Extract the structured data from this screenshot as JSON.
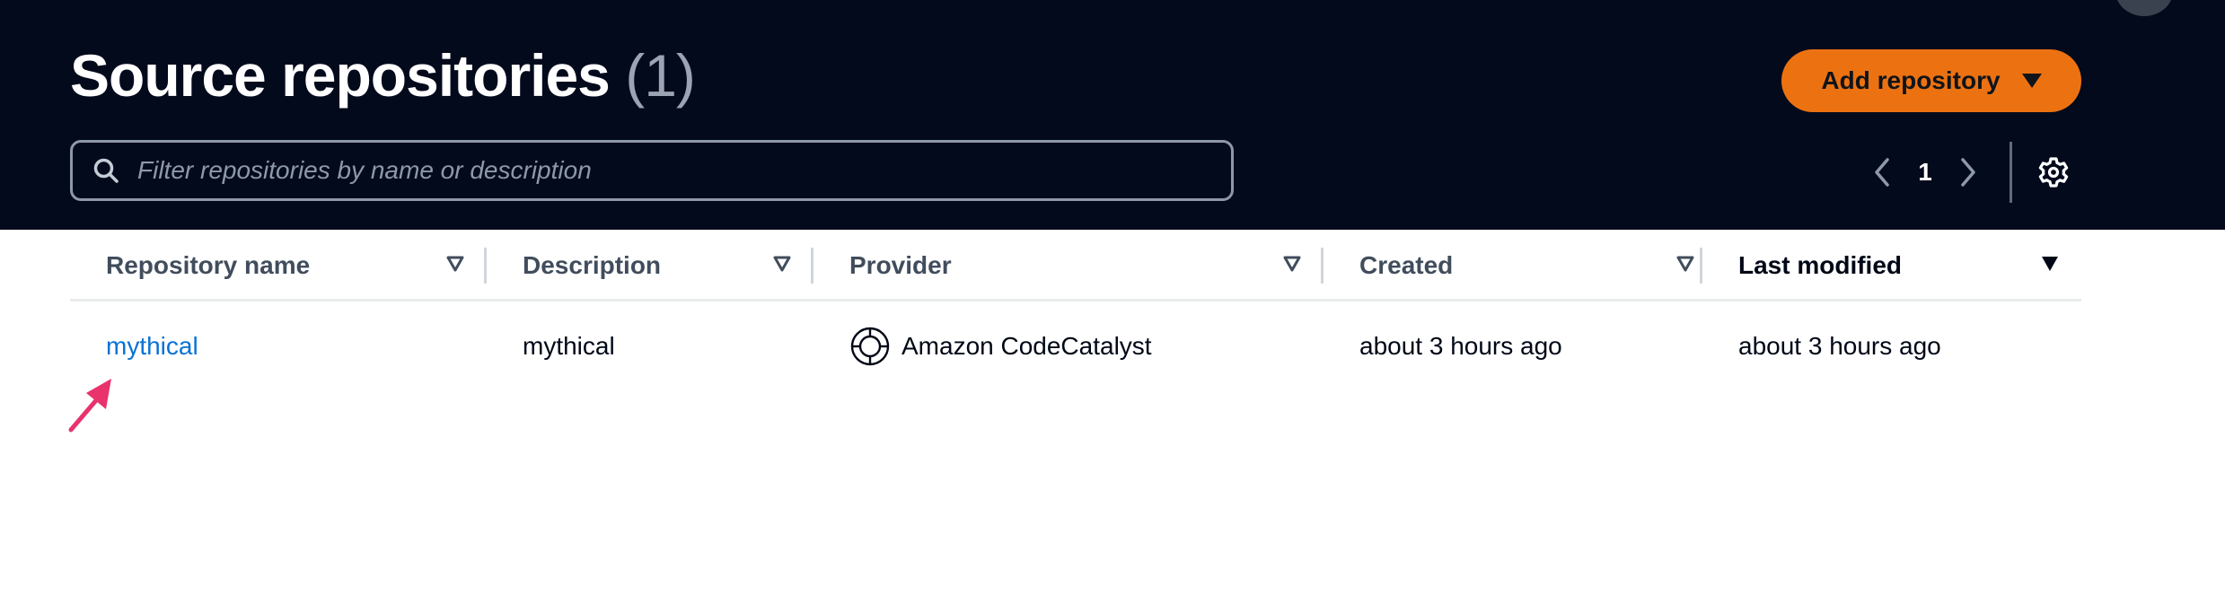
{
  "header": {
    "title": "Source repositories",
    "count": "(1)",
    "add_button_label": "Add repository",
    "search_placeholder": "Filter repositories by name or description",
    "page_number": "1"
  },
  "table": {
    "columns": [
      {
        "label": "Repository name",
        "sorted": false
      },
      {
        "label": "Description",
        "sorted": false
      },
      {
        "label": "Provider",
        "sorted": false
      },
      {
        "label": "Created",
        "sorted": false
      },
      {
        "label": "Last modified",
        "sorted": true
      }
    ],
    "rows": [
      {
        "name": "mythical",
        "description": "mythical",
        "provider": "Amazon CodeCatalyst",
        "created": "about 3 hours ago",
        "last_modified": "about 3 hours ago"
      }
    ]
  },
  "colors": {
    "header_bg": "#030a1c",
    "accent_orange": "#ec7211",
    "link_blue": "#0972d3",
    "annotation_pink": "#e8336d"
  },
  "icons": [
    "search-icon",
    "chevron-left-icon",
    "chevron-right-icon",
    "gear-icon",
    "sort-caret-icon",
    "codecatalyst-icon",
    "annotation-arrow-icon"
  ]
}
